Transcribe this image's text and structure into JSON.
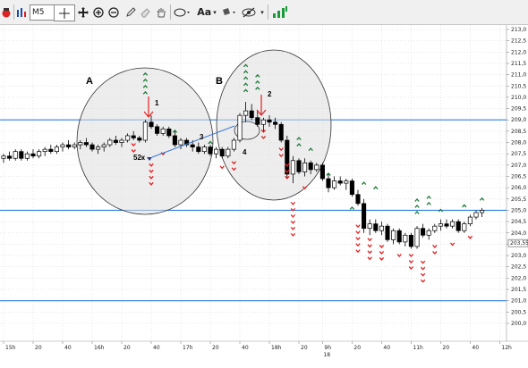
{
  "toolbar": {
    "timeframe": "M5",
    "icons": [
      "app-icon",
      "chart-type-icon",
      "timeframe-select",
      "crosshair-icon",
      "move-icon",
      "zoom-in-icon",
      "zoom-out-icon",
      "pencil-icon",
      "eraser-icon",
      "hand-icon",
      "ellipse-icon",
      "text-tool-icon",
      "fill-tool-icon",
      "hide-icon",
      "strategy-icon"
    ],
    "text_tool_label": "Aa"
  },
  "chart_data": {
    "type": "candlestick",
    "y_ticks": [
      "213,0",
      "212,5",
      "212,0",
      "211,5",
      "211,0",
      "210,5",
      "210,0",
      "209,5",
      "209,0",
      "208,5",
      "208,0",
      "207,5",
      "207,0",
      "206,5",
      "206,0",
      "205,5",
      "205,0",
      "204,5",
      "204,0",
      "203,5",
      "203,0",
      "202,5",
      "202,0",
      "201,5",
      "201,0",
      "200,5",
      "200,0"
    ],
    "ylim": [
      199.8,
      213.2
    ],
    "current_price": "203,55",
    "current_price_value": 203.55,
    "x_ticks": [
      "15h",
      "20",
      "40",
      "16h",
      "20",
      "40",
      "17h",
      "20",
      "40",
      "18h",
      "20",
      "9h",
      "20",
      "40",
      "11h",
      "20",
      "40",
      "12h",
      "20",
      "40",
      "13h",
      "20",
      "40",
      "14h",
      "20"
    ],
    "x_tick_index": [
      0,
      5,
      10,
      15,
      20,
      25,
      30,
      35,
      40,
      45,
      50,
      54,
      59,
      64,
      69,
      74,
      79,
      84,
      89,
      94,
      99,
      104,
      109,
      114,
      118
    ],
    "day_marker": "18",
    "day_marker_index": 54,
    "hlines": [
      209.0,
      205.0,
      201.0
    ],
    "candles": [
      [
        207.3,
        207.5,
        207.1,
        207.4
      ],
      [
        207.4,
        207.6,
        207.2,
        207.3
      ],
      [
        207.3,
        207.7,
        207.2,
        207.6
      ],
      [
        207.6,
        207.7,
        207.2,
        207.3
      ],
      [
        207.3,
        207.6,
        207.2,
        207.5
      ],
      [
        207.5,
        207.7,
        207.3,
        207.4
      ],
      [
        207.4,
        207.7,
        207.3,
        207.6
      ],
      [
        207.6,
        207.8,
        207.4,
        207.7
      ],
      [
        207.7,
        207.9,
        207.5,
        207.6
      ],
      [
        207.6,
        207.9,
        207.5,
        207.8
      ],
      [
        207.8,
        208.0,
        207.6,
        207.9
      ],
      [
        207.9,
        208.1,
        207.7,
        207.8
      ],
      [
        207.8,
        208.0,
        207.7,
        207.9
      ],
      [
        207.9,
        208.1,
        207.7,
        208.0
      ],
      [
        208.0,
        208.2,
        207.8,
        207.9
      ],
      [
        207.9,
        208.0,
        207.6,
        207.7
      ],
      [
        207.7,
        207.9,
        207.5,
        207.8
      ],
      [
        207.8,
        208.0,
        207.6,
        207.9
      ],
      [
        207.9,
        208.2,
        207.8,
        208.1
      ],
      [
        208.1,
        208.3,
        207.9,
        208.0
      ],
      [
        208.0,
        208.2,
        207.8,
        208.1
      ],
      [
        208.1,
        208.4,
        208.0,
        208.3
      ],
      [
        208.3,
        208.5,
        208.1,
        208.2
      ],
      [
        208.2,
        208.3,
        208.0,
        208.1
      ],
      [
        208.1,
        209.0,
        208.0,
        208.9
      ],
      [
        208.9,
        209.2,
        208.6,
        208.7
      ],
      [
        208.7,
        208.8,
        208.3,
        208.4
      ],
      [
        208.4,
        208.7,
        208.3,
        208.6
      ],
      [
        208.6,
        208.7,
        208.2,
        208.3
      ],
      [
        208.3,
        208.5,
        207.8,
        207.9
      ],
      [
        207.9,
        208.2,
        207.7,
        208.1
      ],
      [
        208.1,
        208.2,
        207.8,
        207.9
      ],
      [
        207.9,
        208.1,
        207.6,
        207.8
      ],
      [
        207.8,
        208.0,
        207.5,
        207.6
      ],
      [
        207.6,
        207.9,
        207.5,
        207.8
      ],
      [
        207.8,
        207.9,
        207.4,
        207.5
      ],
      [
        207.5,
        207.8,
        207.3,
        207.7
      ],
      [
        207.7,
        207.8,
        207.3,
        207.4
      ],
      [
        207.4,
        207.8,
        207.3,
        207.7
      ],
      [
        207.7,
        208.2,
        207.6,
        208.1
      ],
      [
        208.1,
        209.3,
        208.0,
        209.2
      ],
      [
        209.2,
        209.8,
        208.9,
        209.4
      ],
      [
        209.4,
        209.7,
        209.0,
        209.1
      ],
      [
        209.1,
        209.4,
        208.7,
        208.8
      ],
      [
        208.8,
        209.1,
        208.5,
        209.0
      ],
      [
        209.0,
        209.2,
        208.7,
        208.9
      ],
      [
        208.9,
        209.1,
        208.6,
        208.8
      ],
      [
        208.8,
        208.9,
        208.0,
        208.1
      ],
      [
        208.1,
        208.3,
        206.4,
        206.6
      ],
      [
        206.6,
        207.4,
        206.2,
        207.2
      ],
      [
        207.2,
        207.3,
        206.6,
        206.7
      ],
      [
        206.7,
        207.3,
        206.5,
        207.1
      ],
      [
        207.1,
        207.2,
        206.6,
        206.8
      ],
      [
        206.8,
        207.1,
        206.7,
        207.0
      ],
      [
        207.0,
        207.1,
        206.3,
        206.4
      ],
      [
        206.4,
        206.6,
        205.8,
        206.0
      ],
      [
        206.0,
        206.5,
        205.9,
        206.3
      ],
      [
        206.3,
        206.5,
        206.1,
        206.2
      ],
      [
        206.2,
        206.4,
        205.9,
        206.3
      ],
      [
        206.3,
        206.4,
        205.6,
        205.7
      ],
      [
        205.7,
        205.9,
        205.2,
        205.3
      ],
      [
        205.3,
        205.5,
        204.0,
        204.2
      ],
      [
        204.2,
        204.6,
        203.9,
        204.4
      ],
      [
        204.4,
        204.6,
        204.0,
        204.1
      ],
      [
        204.1,
        204.5,
        203.9,
        204.3
      ],
      [
        204.3,
        204.4,
        203.6,
        203.7
      ],
      [
        203.7,
        204.2,
        203.5,
        204.1
      ],
      [
        204.1,
        204.2,
        203.5,
        203.6
      ],
      [
        203.6,
        204.0,
        203.4,
        203.9
      ],
      [
        203.9,
        204.0,
        203.3,
        203.4
      ],
      [
        203.4,
        204.3,
        203.3,
        204.2
      ],
      [
        204.2,
        204.4,
        203.8,
        203.9
      ],
      [
        203.9,
        204.2,
        203.7,
        204.1
      ],
      [
        204.1,
        204.4,
        204.0,
        204.3
      ],
      [
        204.3,
        204.6,
        204.1,
        204.4
      ],
      [
        204.4,
        204.6,
        204.2,
        204.3
      ],
      [
        204.3,
        204.6,
        204.2,
        204.5
      ],
      [
        204.5,
        204.6,
        204.0,
        204.1
      ],
      [
        204.1,
        204.5,
        204.0,
        204.4
      ],
      [
        204.4,
        204.8,
        204.3,
        204.7
      ],
      [
        204.7,
        205.0,
        204.6,
        204.9
      ],
      [
        204.9,
        205.1,
        204.7,
        205.0
      ]
    ],
    "annotations": [
      "A",
      "B",
      "1",
      "2",
      "3",
      "4",
      "52к"
    ]
  }
}
